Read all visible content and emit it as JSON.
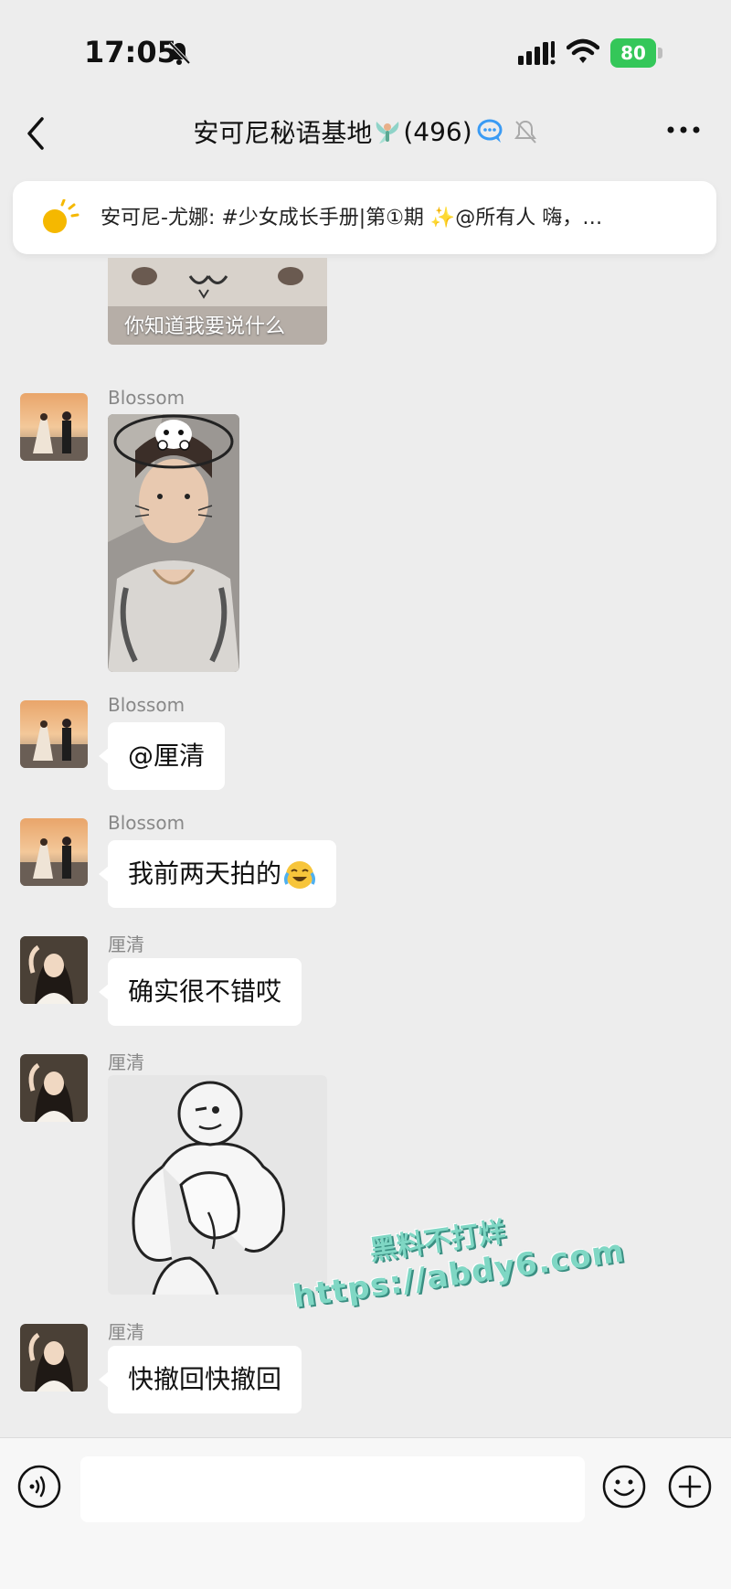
{
  "status_bar": {
    "time": "17:05",
    "battery": "80"
  },
  "header": {
    "title": "安可尼秘语基地",
    "member_count": "(496)"
  },
  "announcement": {
    "text": "安可尼-尤娜: #少女成长手册|第①期 ✨@所有人  嗨，…"
  },
  "messages": [
    {
      "type": "image",
      "caption": "你知道我要说什么"
    },
    {
      "sender": "Blossom",
      "type": "image"
    },
    {
      "sender": "Blossom",
      "type": "text",
      "text": "@厘清"
    },
    {
      "sender": "Blossom",
      "type": "text",
      "text": "我前两天拍的"
    },
    {
      "sender": "厘清",
      "type": "text",
      "text": "确实很不错哎"
    },
    {
      "sender": "厘清",
      "type": "image"
    },
    {
      "sender": "厘清",
      "type": "text",
      "text": "快撤回快撤回"
    }
  ],
  "watermark": {
    "line1": "黑料不打烊",
    "line2": "https://abdy6.com"
  },
  "input": {
    "value": ""
  },
  "icons": [
    "back-icon",
    "bell-off-icon",
    "signal-icon",
    "wifi-icon",
    "more-icon",
    "sun-icon",
    "voice-icon",
    "emoji-icon",
    "plus-icon"
  ],
  "colors": {
    "background": "#ededed",
    "battery": "#34c759",
    "bubble": "#ffffff",
    "watermark": "#7fd7c4"
  }
}
